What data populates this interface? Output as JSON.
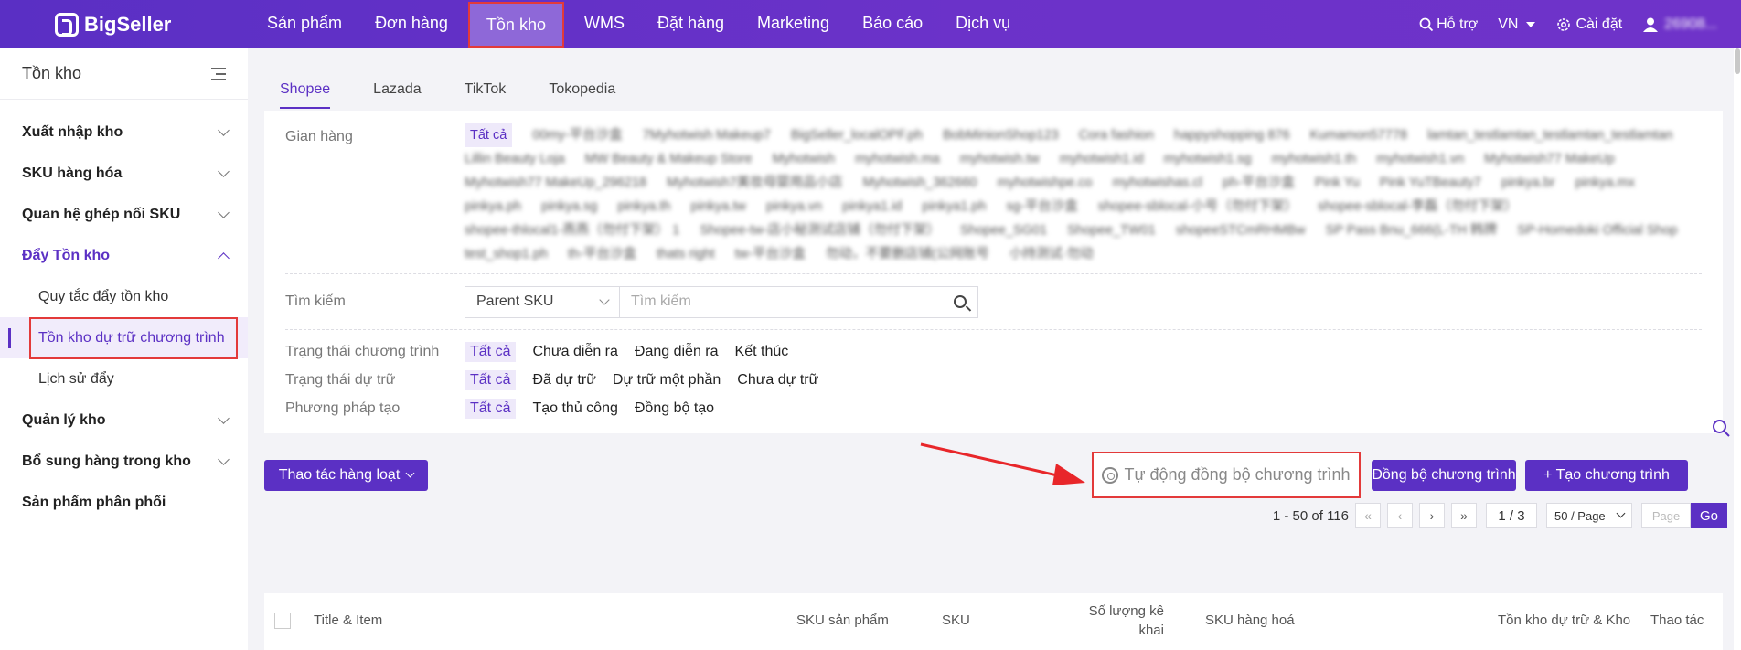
{
  "brand": {
    "name": "BigSeller"
  },
  "nav": {
    "items": [
      "Sản phẩm",
      "Đơn hàng",
      "Tồn kho",
      "WMS",
      "Đặt hàng",
      "Marketing",
      "Báo cáo",
      "Dịch vụ"
    ],
    "active": "Tồn kho",
    "support": "Hỗ trợ",
    "language": "VN",
    "settings": "Cài đặt",
    "user": "26908..."
  },
  "sidebar": {
    "title": "Tồn kho",
    "items": [
      {
        "label": "Xuất nhập kho"
      },
      {
        "label": "SKU hàng hóa"
      },
      {
        "label": "Quan hệ ghép nối SKU"
      },
      {
        "label": "Đẩy Tồn kho",
        "open": true
      },
      {
        "label": "Quản lý kho"
      },
      {
        "label": "Bổ sung hàng trong kho"
      },
      {
        "label": "Sản phẩm phân phối"
      }
    ],
    "sub_items": [
      "Quy tắc đẩy tồn kho",
      "Tồn kho dự trữ chương trình",
      "Lịch sử đẩy"
    ],
    "selected_sub": "Tồn kho dự trữ chương trình"
  },
  "tabs": [
    "Shopee",
    "Lazada",
    "TikTok",
    "Tokopedia"
  ],
  "active_tab": "Shopee",
  "filters": {
    "store_label": "Gian hàng",
    "all": "Tất cả",
    "stores": [
      "00my-平台沙盒",
      "7Myhotwish Makeup7",
      "BigSeller_localOPF.ph",
      "BobMinionShop123",
      "Cora fashion",
      "happyshopping 876",
      "Kumamon57778",
      "lamtan_testlamtan_testlamtan_testlamtan",
      "Lillin Beauty Loja",
      "MW Beauty & Makeup Store",
      "Myhotwish",
      "myhotwish.ma",
      "myhotwish.tw",
      "myhotwish1.id",
      "myhotwish1.sg",
      "myhotwish1.th",
      "myhotwish1.vn",
      "Myhotwish77 MakeUp",
      "Myhotwish77 MakeUp_296218",
      "Myhotwish7美妆母婴用品小店",
      "Myhotwish_362660",
      "myhotwishpe.co",
      "myhotwishas.cl",
      "ph-平台沙盒",
      "Pink Yu",
      "Pink YuTBeauty7",
      "pinkya.br",
      "pinkya.mx",
      "pinkya.ph",
      "pinkya.sg",
      "pinkya.th",
      "pinkya.tw",
      "pinkya.vn",
      "pinkya1.id",
      "pinkya1.ph",
      "sg-平台沙盒",
      "shopee-sblocal-小号（勿付下架）",
      "shopee-sblocal-李磊（勿付下架）",
      "shopee-thlocal1-燕燕（勿付下架） 1",
      "Shopee-tw-店小秘测试店铺（勿付下架）",
      "Shopee_SG01",
      "Shopee_TW01",
      "shopeeSTCmRHMBw",
      "SP Pass Bnu_666(L-TH 韩牌",
      "SP-Homedoki Official Shop",
      "test_shop1.ph",
      "th-平台沙盒",
      "thats right",
      "tw-平台沙盒",
      "勿动，不要删店铺(公网账号",
      "小持测试·勿动"
    ],
    "search_label": "Tìm kiếm",
    "search_field": "Parent SKU",
    "search_placeholder": "Tìm kiếm",
    "program_status_label": "Trạng thái chương trình",
    "program_status": [
      "Tất cả",
      "Chưa diễn ra",
      "Đang diễn ra",
      "Kết thúc"
    ],
    "reserve_status_label": "Trạng thái dự trữ",
    "reserve_status": [
      "Tất cả",
      "Đã dự trữ",
      "Dự trữ một phần",
      "Chưa dự trữ"
    ],
    "create_method_label": "Phương pháp tạo",
    "create_method": [
      "Tất cả",
      "Tạo thủ công",
      "Đồng bộ tạo"
    ]
  },
  "toolbar": {
    "bulk": "Thao tác hàng loạt",
    "auto_sync": "Tự động đồng bộ chương trình",
    "sync": "Đồng bộ chương trình",
    "create": "+ Tạo chương trình"
  },
  "pagination": {
    "summary": "1 - 50 of 116",
    "page": "1 / 3",
    "page_size": "50 / Page",
    "page_placeholder": "Page",
    "go": "Go"
  },
  "table": {
    "columns": [
      "Title & Item",
      "SKU sản phẩm",
      "SKU",
      "Số lượng kê khai",
      "SKU hàng hoá",
      "Tồn kho dự trữ & Kho",
      "Thao tác"
    ]
  },
  "colors": {
    "primary": "#5b30c4",
    "highlight_border": "#e33a3a"
  }
}
